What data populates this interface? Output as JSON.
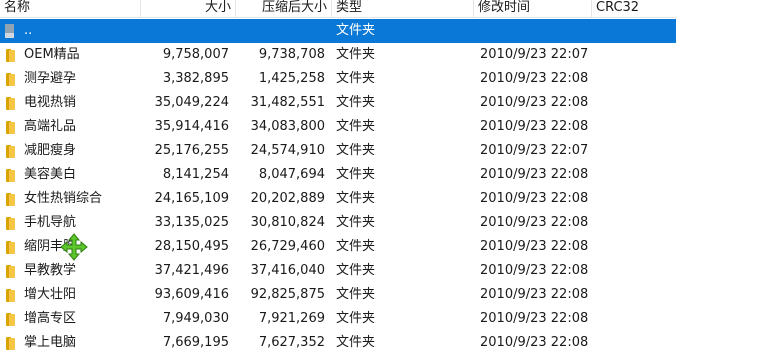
{
  "columns": {
    "name": "名称",
    "size": "大小",
    "compressed": "压缩后大小",
    "type": "类型",
    "modified": "修改时间",
    "crc": "CRC32"
  },
  "parent_row": {
    "name": "..",
    "type": "文件夹"
  },
  "rows": [
    {
      "name": "OEM精品",
      "size": "9,758,007",
      "compressed": "9,738,708",
      "type": "文件夹",
      "modified": "2010/9/23 22:07"
    },
    {
      "name": "测孕避孕",
      "size": "3,382,895",
      "compressed": "1,425,258",
      "type": "文件夹",
      "modified": "2010/9/23 22:08"
    },
    {
      "name": "电视热销",
      "size": "35,049,224",
      "compressed": "31,482,551",
      "type": "文件夹",
      "modified": "2010/9/23 22:08"
    },
    {
      "name": "高端礼品",
      "size": "35,914,416",
      "compressed": "34,083,800",
      "type": "文件夹",
      "modified": "2010/9/23 22:08"
    },
    {
      "name": "减肥瘦身",
      "size": "25,176,255",
      "compressed": "24,574,910",
      "type": "文件夹",
      "modified": "2010/9/23 22:07"
    },
    {
      "name": "美容美白",
      "size": "8,141,254",
      "compressed": "8,047,694",
      "type": "文件夹",
      "modified": "2010/9/23 22:08"
    },
    {
      "name": "女性热销综合",
      "size": "24,165,109",
      "compressed": "20,202,889",
      "type": "文件夹",
      "modified": "2010/9/23 22:08"
    },
    {
      "name": "手机导航",
      "size": "33,135,025",
      "compressed": "30,810,824",
      "type": "文件夹",
      "modified": "2010/9/23 22:08"
    },
    {
      "name": "缩阴丰胸",
      "size": "28,150,495",
      "compressed": "26,729,460",
      "type": "文件夹",
      "modified": "2010/9/23 22:08"
    },
    {
      "name": "早教教学",
      "size": "37,421,496",
      "compressed": "37,416,040",
      "type": "文件夹",
      "modified": "2010/9/23 22:08"
    },
    {
      "name": "增大壮阳",
      "size": "93,609,416",
      "compressed": "92,825,875",
      "type": "文件夹",
      "modified": "2010/9/23 22:08"
    },
    {
      "name": "增高专区",
      "size": "7,949,030",
      "compressed": "7,921,269",
      "type": "文件夹",
      "modified": "2010/9/23 22:08"
    },
    {
      "name": "掌上电脑",
      "size": "7,669,195",
      "compressed": "7,627,352",
      "type": "文件夹",
      "modified": "2010/9/23 22:08"
    }
  ],
  "colors": {
    "selection": "#0a78d7",
    "folder_front": "#f6c744",
    "folder_back": "#d9a400",
    "move_cursor": "#5cc72a"
  }
}
